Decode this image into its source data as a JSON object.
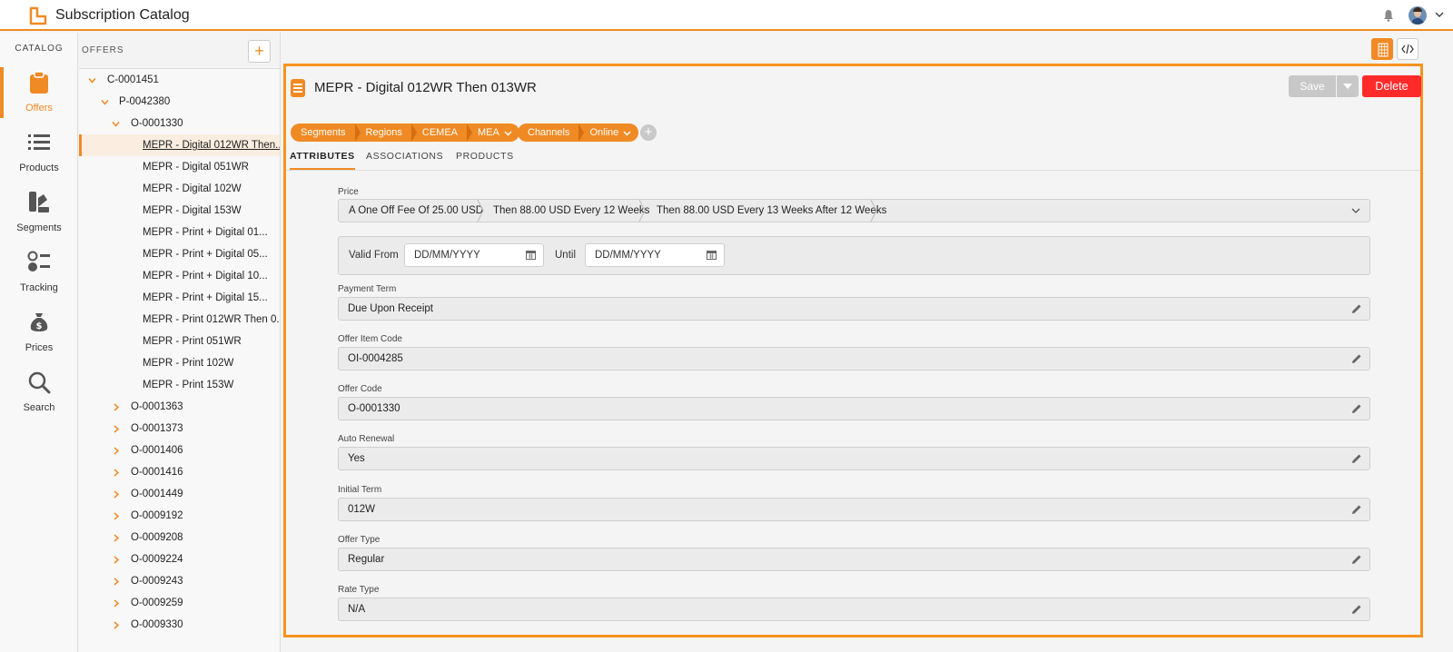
{
  "app": {
    "title": "Subscription Catalog"
  },
  "nav": {
    "heading": "CATALOG",
    "items": [
      {
        "label": "Offers",
        "icon": "clipboard-icon",
        "active": true
      },
      {
        "label": "Products",
        "icon": "list-icon"
      },
      {
        "label": "Segments",
        "icon": "swatches-icon"
      },
      {
        "label": "Tracking",
        "icon": "tracking-list-icon"
      },
      {
        "label": "Prices",
        "icon": "money-bag-icon"
      },
      {
        "label": "Search",
        "icon": "search-icon"
      }
    ]
  },
  "tree": {
    "title": "OFFERS",
    "add_label": "+",
    "rows": [
      {
        "label": "C-0001451",
        "expanded": true
      },
      {
        "label": "P-0042380",
        "expanded": true
      },
      {
        "label": "O-0001330",
        "expanded": true
      },
      {
        "label": "MEPR - Digital 012WR Then...",
        "selected": true
      },
      {
        "label": "MEPR - Digital 051WR"
      },
      {
        "label": "MEPR - Digital 102W"
      },
      {
        "label": "MEPR - Digital 153W"
      },
      {
        "label": "MEPR - Print + Digital 01..."
      },
      {
        "label": "MEPR - Print + Digital 05..."
      },
      {
        "label": "MEPR - Print + Digital 10..."
      },
      {
        "label": "MEPR - Print + Digital 15..."
      },
      {
        "label": "MEPR - Print 012WR Then 0..."
      },
      {
        "label": "MEPR - Print 051WR"
      },
      {
        "label": "MEPR - Print 102W"
      },
      {
        "label": "MEPR - Print 153W"
      },
      {
        "label": "O-0001363"
      },
      {
        "label": "O-0001373"
      },
      {
        "label": "O-0001406"
      },
      {
        "label": "O-0001416"
      },
      {
        "label": "O-0001449"
      },
      {
        "label": "O-0009192"
      },
      {
        "label": "O-0009208"
      },
      {
        "label": "O-0009224"
      },
      {
        "label": "O-0009243"
      },
      {
        "label": "O-0009259"
      },
      {
        "label": "O-0009330"
      }
    ]
  },
  "record": {
    "title": "MEPR - Digital 012WR Then 013WR",
    "save_label": "Save",
    "delete_label": "Delete",
    "breadcrumbs_segments": [
      "Segments",
      "Regions",
      "CEMEA",
      "MEA"
    ],
    "breadcrumbs_channels": [
      "Channels",
      "Online"
    ],
    "add_crumb_label": "+",
    "tabs": [
      "ATTRIBUTES",
      "ASSOCIATIONS",
      "PRODUCTS"
    ],
    "price": {
      "label": "Price",
      "segments": [
        "A One Off Fee Of 25.00 USD",
        "Then 88.00 USD Every 12 Weeks",
        "Then 88.00 USD Every 13 Weeks After 12 Weeks"
      ]
    },
    "validity": {
      "from_label": "Valid From",
      "from_placeholder": "DD/MM/YYYY",
      "until_label": "Until",
      "until_placeholder": "DD/MM/YYYY"
    },
    "fields": [
      {
        "label": "Payment Term",
        "value": "Due Upon Receipt"
      },
      {
        "label": "Offer Item Code",
        "value": "OI-0004285"
      },
      {
        "label": "Offer Code",
        "value": "O-0001330"
      },
      {
        "label": "Auto Renewal",
        "value": "Yes"
      },
      {
        "label": "Initial Term",
        "value": "012W"
      },
      {
        "label": "Offer Type",
        "value": "Regular"
      },
      {
        "label": "Rate Type",
        "value": "N/A"
      }
    ]
  },
  "colors": {
    "accent": "#f08a24",
    "delete": "#ff2b2b",
    "panel_border": "#f7931e"
  }
}
